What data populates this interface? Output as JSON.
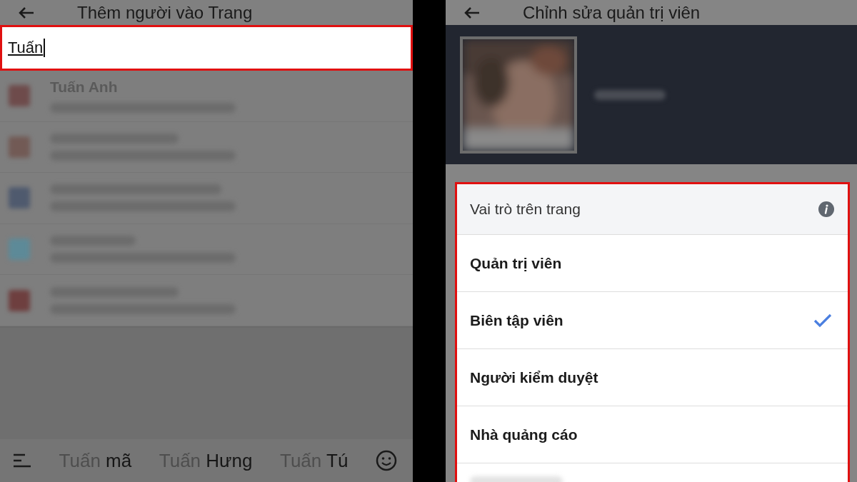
{
  "left_screen": {
    "title": "Thêm người vào Trang",
    "search": {
      "value": "Tuấn",
      "highlighted": true
    },
    "results": [
      {
        "name": "Tuấn Anh",
        "color": "#6e4b4b"
      },
      {
        "color": "#725a55"
      },
      {
        "color": "#4f5a6e"
      },
      {
        "color": "#5d8a98"
      },
      {
        "color": "#6e3f3f"
      }
    ],
    "suggestions": [
      {
        "typed": "Tuấn",
        "completion": "mã"
      },
      {
        "typed": "Tuấn",
        "completion": "Hưng"
      },
      {
        "typed": "Tuấn",
        "completion": "Tú"
      }
    ]
  },
  "right_screen": {
    "title": "Chỉnh sửa quản trị viên",
    "roles": {
      "heading": "Vai trò trên trang",
      "highlighted": true,
      "items": [
        {
          "label": "Quản trị viên",
          "selected": false
        },
        {
          "label": "Biên tập viên",
          "selected": true
        },
        {
          "label": "Người kiểm duyệt",
          "selected": false
        },
        {
          "label": "Nhà quảng cáo",
          "selected": false
        }
      ]
    }
  }
}
